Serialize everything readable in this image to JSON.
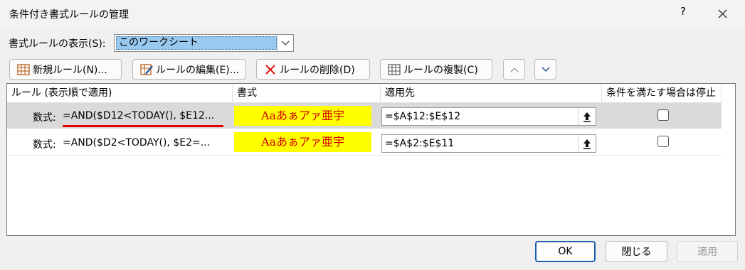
{
  "window": {
    "title": "条件付き書式ルールの管理",
    "help_label": "?"
  },
  "show_rules": {
    "label": "書式ルールの表示(S):",
    "selected": "このワークシート"
  },
  "toolbar": {
    "new_label": "新規ルール(N)...",
    "edit_label": "ルールの編集(E)...",
    "delete_label": "ルールの削除(D)",
    "duplicate_label": "ルールの複製(C)"
  },
  "table": {
    "headers": [
      "ルール (表示順で適用)",
      "書式",
      "適用先",
      "条件を満たす場合は停止"
    ],
    "rows": [
      {
        "rule_prefix": "数式:",
        "rule_formula": "=AND($D12<TODAY(), $E12...",
        "format_sample": "Aaあぁアァ亜宇",
        "applies_to": "=$A$12:$E$12",
        "stop_if_true": false
      },
      {
        "rule_prefix": "数式:",
        "rule_formula": "=AND($D2<TODAY(), $E2=...",
        "format_sample": "Aaあぁアァ亜宇",
        "applies_to": "=$A$2:$E$11",
        "stop_if_true": false
      }
    ]
  },
  "footer": {
    "ok_label": "OK",
    "close_label": "閉じる",
    "apply_label": "適用"
  },
  "colors": {
    "format_fill": "#ffff00",
    "format_text": "#d40000",
    "selection": "#99c9ef",
    "annotation_underline": "#e40000"
  }
}
